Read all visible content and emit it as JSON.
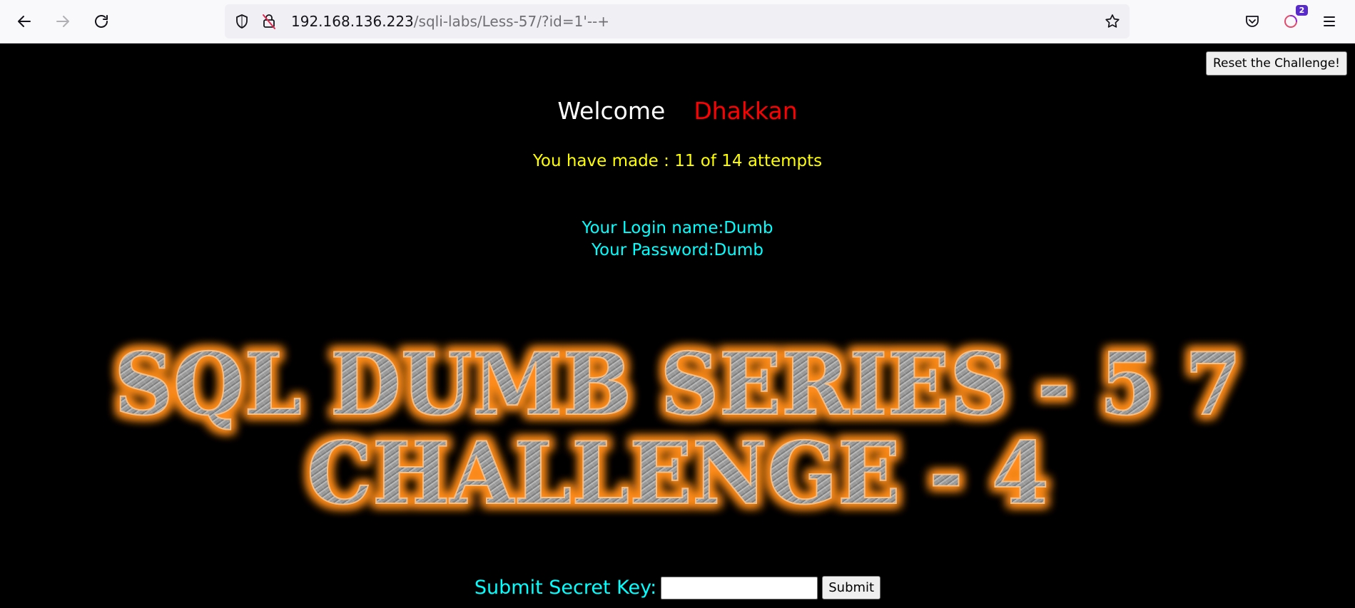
{
  "browser": {
    "url_host": "192.168.136.223",
    "url_path": "/sqli-labs/Less-57/?id=1'--+",
    "extension_badge": "2",
    "icons": {
      "back": "back-arrow-icon",
      "forward": "forward-arrow-icon",
      "reload": "reload-icon",
      "shield": "tracking-protection-shield-icon",
      "insecure": "insecure-lock-icon",
      "bookmark": "star-icon",
      "pocket": "pocket-icon",
      "account": "firefox-account-icon",
      "menu": "hamburger-menu-icon"
    }
  },
  "page": {
    "reset_label": "Reset the Challenge!",
    "welcome_word": "Welcome",
    "user_name": "Dhakkan",
    "attempts_text": "You have made : 11 of 14 attempts",
    "login_name": "Your Login name:Dumb",
    "password": "Your Password:Dumb",
    "banner_line1": "SQL DUMB SERIES - 5 7",
    "banner_line2": "CHALLENGE - 4",
    "secret_label": "Submit Secret Key:",
    "secret_value": "",
    "submit_label": "Submit"
  },
  "colors": {
    "welcome": "#ffffff",
    "user_name": "#ff0000",
    "attempts": "#ffff00",
    "login_info": "#00ffff",
    "banner_glow": "#ff8c1a",
    "background": "#000000"
  }
}
